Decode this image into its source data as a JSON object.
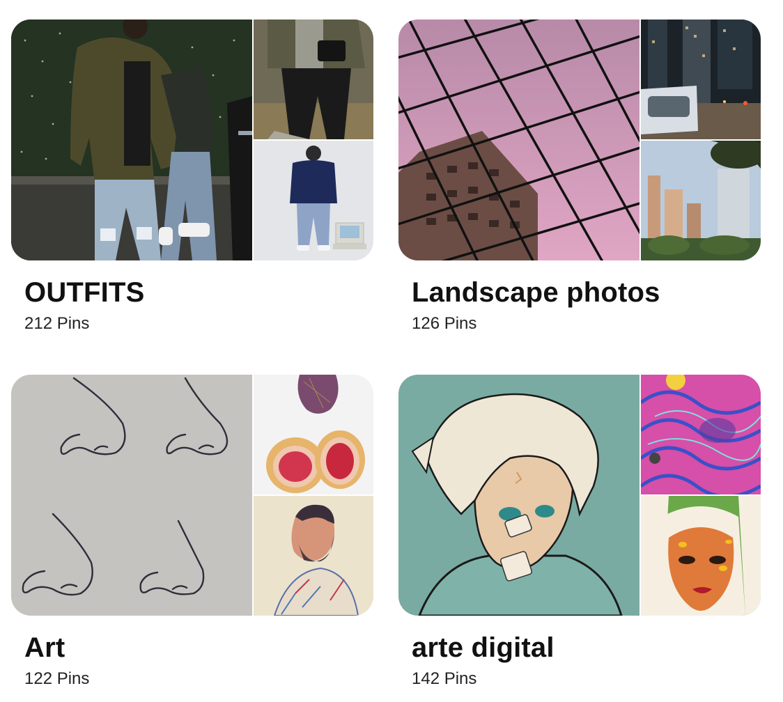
{
  "boards": [
    {
      "title": "OUTFITS",
      "count": "212 Pins",
      "images": [
        "man-in-green-bomber-jacket-photo",
        "man-with-crossbody-bag-photo",
        "man-in-navy-sweatshirt-with-old-computer-photo"
      ]
    },
    {
      "title": "Landscape photos",
      "count": "126 Pins",
      "images": [
        "chain-link-fence-pink-sky-photo",
        "snowy-city-street-at-night-photo",
        "city-skyline-with-trees-photo"
      ]
    },
    {
      "title": "Art",
      "count": "122 Pins",
      "images": [
        "nose-sketches-drawing",
        "fig-fruit-illustration",
        "bearded-man-portrait-drawing"
      ]
    },
    {
      "title": "arte digital",
      "count": "142 Pins",
      "images": [
        "white-haired-anime-boy-illustration",
        "psychedelic-pink-blue-illustration",
        "woman-with-bees-illustration"
      ]
    }
  ]
}
